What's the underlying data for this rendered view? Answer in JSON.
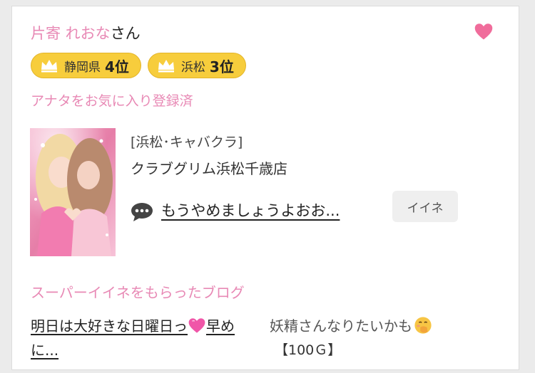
{
  "profile": {
    "name_pink": "片寄 れおな",
    "name_suffix": "さん",
    "favorite_icon": "heart-icon",
    "favorite_color": "#f06c9b"
  },
  "rankings": [
    {
      "region": "静岡県",
      "rank": "4位",
      "icon": "crown-icon"
    },
    {
      "region": "浜松",
      "rank": "3位",
      "icon": "crown-icon"
    }
  ],
  "favorite_status": "アナタをお気に入り登録済",
  "shop": {
    "category": "[浜松･キャバクラ]",
    "name": "クラブグリム浜松千歳店"
  },
  "latest_comment": {
    "icon": "speech-bubble-icon",
    "text": "もうやめましょうよおお...",
    "like_label": "イイネ"
  },
  "super_iine": {
    "heading": "スーパーイイネをもらったブログ",
    "blog_title_part1": "明日は大好きな日曜日っ",
    "blog_title_part2": "早めに...",
    "author": "妖精さんなりたいかも",
    "price": "【100Ｇ】"
  },
  "colors": {
    "accent_pink": "#e889b5",
    "badge_yellow": "#f7cd3c"
  }
}
